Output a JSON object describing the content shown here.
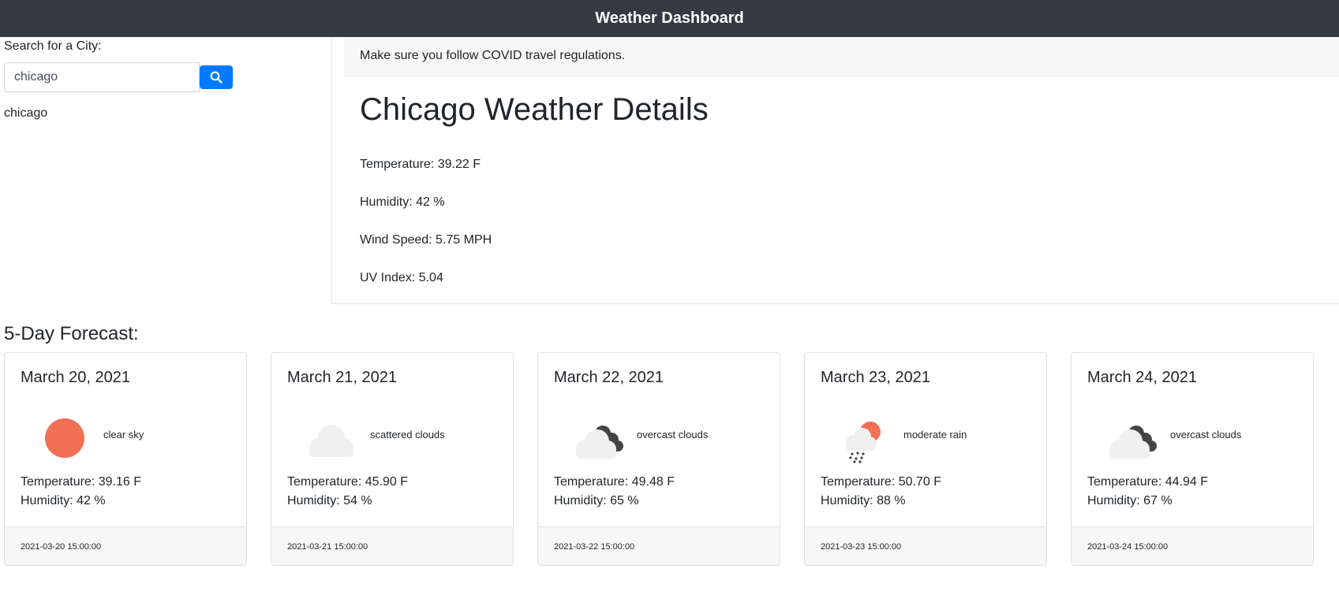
{
  "navbar": {
    "title": "Weather Dashboard"
  },
  "search": {
    "label": "Search for a City:",
    "value": "chicago",
    "button_icon": "search-icon",
    "history": [
      "chicago"
    ]
  },
  "current": {
    "notice": "Make sure you follow COVID travel regulations.",
    "title": "Chicago Weather Details",
    "temperature": "Temperature: 39.22 F",
    "humidity": "Humidity: 42 %",
    "wind": "Wind Speed: 5.75 MPH",
    "uv": "UV Index: 5.04"
  },
  "forecast": {
    "heading": "5-Day Forecast:",
    "days": [
      {
        "date": "March 20, 2021",
        "icon": "sun-icon",
        "desc": "clear sky",
        "temp": "Temperature: 39.16 F",
        "humidity": "Humidity: 42 %",
        "footer": "2021-03-20 15:00:00"
      },
      {
        "date": "March 21, 2021",
        "icon": "cloud-icon",
        "desc": "scattered clouds",
        "temp": "Temperature: 45.90 F",
        "humidity": "Humidity: 54 %",
        "footer": "2021-03-21 15:00:00"
      },
      {
        "date": "March 22, 2021",
        "icon": "overcast-clouds-icon",
        "desc": "overcast clouds",
        "temp": "Temperature: 49.48 F",
        "humidity": "Humidity: 65 %",
        "footer": "2021-03-22 15:00:00"
      },
      {
        "date": "March 23, 2021",
        "icon": "rain-icon",
        "desc": "moderate rain",
        "temp": "Temperature: 50.70 F",
        "humidity": "Humidity: 88 %",
        "footer": "2021-03-23 15:00:00"
      },
      {
        "date": "March 24, 2021",
        "icon": "overcast-clouds-icon",
        "desc": "overcast clouds",
        "temp": "Temperature: 44.94 F",
        "humidity": "Humidity: 67 %",
        "footer": "2021-03-24 15:00:00"
      }
    ]
  },
  "colors": {
    "navbar": "#343a40",
    "primary": "#007bff",
    "sun": "#f07055",
    "cloud_light": "#f0f0f0",
    "cloud_dark": "#444444"
  }
}
